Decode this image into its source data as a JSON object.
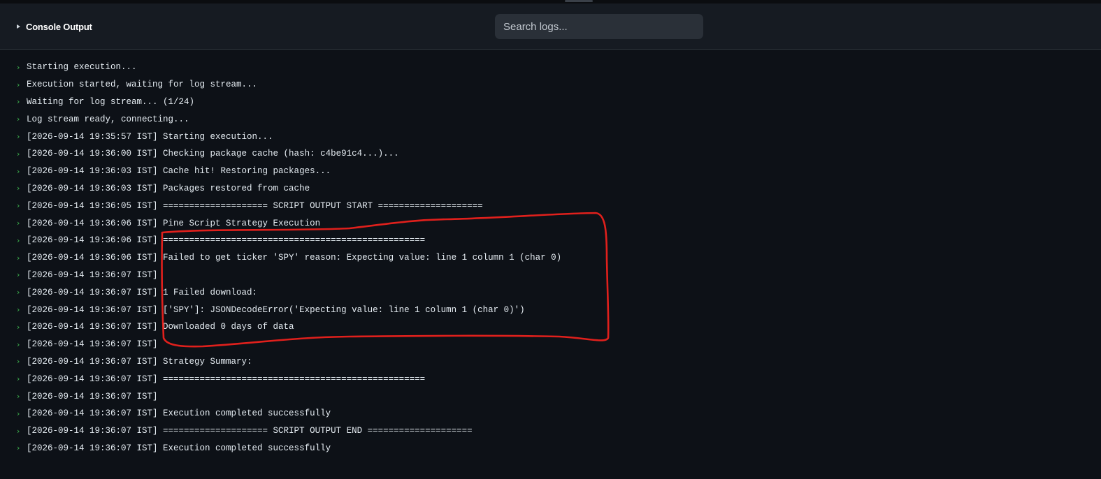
{
  "header": {
    "title": "Console Output",
    "search_placeholder": "Search logs..."
  },
  "icons": {
    "toggle": "caret-right-icon",
    "line_prompt": "chevron-right-icon"
  },
  "colors": {
    "background": "#0d1117",
    "header": "#161b22",
    "prompt": "#3fb950",
    "annotation": "#e0201c"
  },
  "logs": [
    "Starting execution...",
    "Execution started, waiting for log stream...",
    "Waiting for log stream... (1/24)",
    "Log stream ready, connecting...",
    "[2026-09-14 19:35:57 IST] Starting execution...",
    "[2026-09-14 19:36:00 IST] Checking package cache (hash: c4be91c4...)...",
    "[2026-09-14 19:36:03 IST] Cache hit! Restoring packages...",
    "[2026-09-14 19:36:03 IST] Packages restored from cache",
    "[2026-09-14 19:36:05 IST] ==================== SCRIPT OUTPUT START ====================",
    "[2026-09-14 19:36:06 IST] Pine Script Strategy Execution",
    "[2026-09-14 19:36:06 IST] ==================================================",
    "[2026-09-14 19:36:06 IST] Failed to get ticker 'SPY' reason: Expecting value: line 1 column 1 (char 0)",
    "[2026-09-14 19:36:07 IST]",
    "[2026-09-14 19:36:07 IST] 1 Failed download:",
    "[2026-09-14 19:36:07 IST] ['SPY']: JSONDecodeError('Expecting value: line 1 column 1 (char 0)')",
    "[2026-09-14 19:36:07 IST] Downloaded 0 days of data",
    "[2026-09-14 19:36:07 IST]",
    "[2026-09-14 19:36:07 IST] Strategy Summary:",
    "[2026-09-14 19:36:07 IST] ==================================================",
    "[2026-09-14 19:36:07 IST]",
    "[2026-09-14 19:36:07 IST] Execution completed successfully",
    "[2026-09-14 19:36:07 IST] ==================== SCRIPT OUTPUT END ====================",
    "[2026-09-14 19:36:07 IST] Execution completed successfully"
  ]
}
